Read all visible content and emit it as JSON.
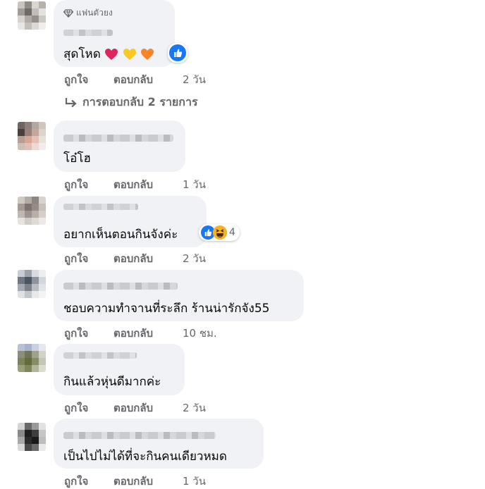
{
  "comments": [
    {
      "badge": "แฟนตัวยง",
      "text": "สุดโหด",
      "emojis": [
        "red-heart",
        "yellow-heart",
        "orange-heart"
      ],
      "like_label": "ถูกใจ",
      "reply_label": "ตอบกลับ",
      "time": "2 วัน",
      "replies_link": "การตอบกลับ 2 รายการ",
      "reactions": [
        "like"
      ],
      "reaction_count": ""
    },
    {
      "text": "โอ๋โฮ",
      "like_label": "ถูกใจ",
      "reply_label": "ตอบกลับ",
      "time": "1 วัน"
    },
    {
      "text": "อยากเห็นตอนกินจังค่ะ",
      "like_label": "ถูกใจ",
      "reply_label": "ตอบกลับ",
      "time": "2 วัน",
      "reactions": [
        "like",
        "haha"
      ],
      "reaction_count": "4"
    },
    {
      "text": "ชอบความทำจานที่ระลึก ร้านน่ารักจัง55",
      "like_label": "ถูกใจ",
      "reply_label": "ตอบกลับ",
      "time": "10 ชม."
    },
    {
      "text": "กินแล้วหุ่นดีมากค่ะ",
      "like_label": "ถูกใจ",
      "reply_label": "ตอบกลับ",
      "time": "2 วัน"
    },
    {
      "text": "เป็นไปไม่ได้ที่จะกินคนเดียวหมด",
      "like_label": "ถูกใจ",
      "reply_label": "ตอบกลับ",
      "time": "1 วัน"
    }
  ],
  "colors": {
    "bubble": "#f0f2f5",
    "secondary_text": "#65676b",
    "like_blue": "#1877f2"
  }
}
